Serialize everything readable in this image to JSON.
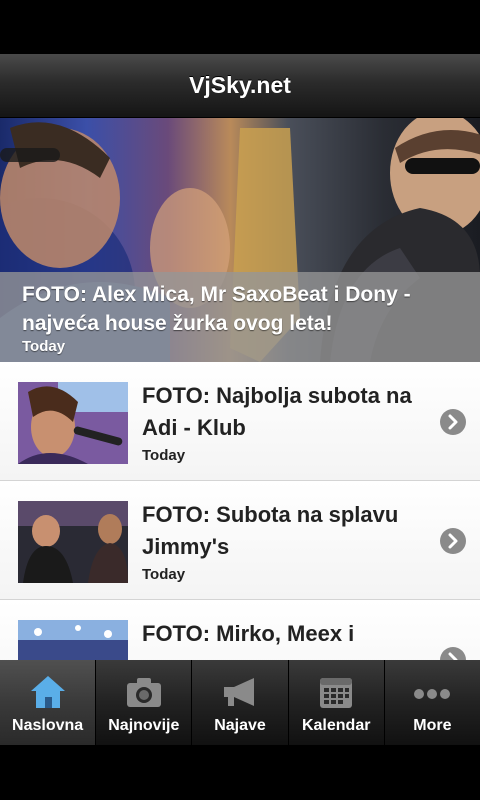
{
  "app": {
    "title": "VjSky.net"
  },
  "hero": {
    "headline": "FOTO: Alex Mica, Mr SaxoBeat i Dony - najveća house žurka ovog leta!",
    "date": "Today"
  },
  "articles": [
    {
      "headline": "FOTO: Najbolja subota na Adi - Klub",
      "date": "Today"
    },
    {
      "headline": "FOTO: Subota na splavu Jimmy's",
      "date": "Today"
    },
    {
      "headline": "FOTO: Mirko, Meex i",
      "date": ""
    }
  ],
  "tabs": [
    {
      "label": "Naslovna",
      "icon": "home-icon",
      "active": true
    },
    {
      "label": "Najnovije",
      "icon": "camera-icon"
    },
    {
      "label": "Najave",
      "icon": "megaphone-icon"
    },
    {
      "label": "Kalendar",
      "icon": "calendar-icon"
    },
    {
      "label": "More",
      "icon": "more-icon"
    }
  ],
  "colors": {
    "tab_active_icon": "#5aaee8",
    "tab_inactive_icon": "#8a8a8a"
  }
}
